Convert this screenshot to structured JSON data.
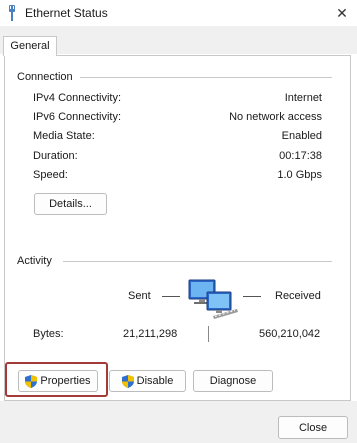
{
  "window": {
    "title": "Ethernet Status",
    "close_glyph": "✕"
  },
  "tabs": [
    {
      "label": "General"
    }
  ],
  "connection": {
    "group_label": "Connection",
    "rows": [
      {
        "label": "IPv4 Connectivity:",
        "value": "Internet"
      },
      {
        "label": "IPv6 Connectivity:",
        "value": "No network access"
      },
      {
        "label": "Media State:",
        "value": "Enabled"
      },
      {
        "label": "Duration:",
        "value": "00:17:38"
      },
      {
        "label": "Speed:",
        "value": "1.0 Gbps"
      }
    ],
    "details_button": "Details..."
  },
  "activity": {
    "group_label": "Activity",
    "sent_label": "Sent",
    "received_label": "Received",
    "bytes_label": "Bytes:",
    "bytes_sent": "21,211,298",
    "bytes_received": "560,210,042",
    "network_icon": "network-computers-icon"
  },
  "buttons": {
    "properties": "Properties",
    "disable": "Disable",
    "diagnose": "Diagnose",
    "close": "Close"
  },
  "colors": {
    "highlight": "#a23a37",
    "shield_blue": "#2f6fd0",
    "shield_yellow": "#f2c200"
  }
}
